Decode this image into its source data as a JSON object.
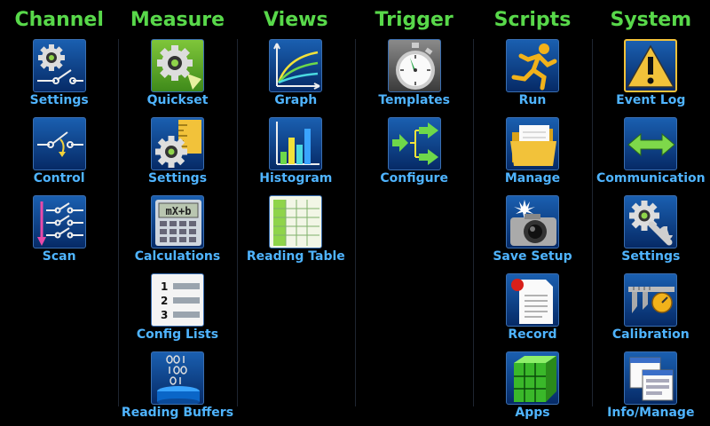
{
  "channel": {
    "title": "Channel",
    "settings": "Settings",
    "control": "Control",
    "scan": "Scan"
  },
  "measure": {
    "title": "Measure",
    "quickset": "Quickset",
    "settings": "Settings",
    "calculations": "Calculations",
    "config_lists": "Config Lists",
    "reading_buffers": "Reading Buffers",
    "calc_display": "mX+b",
    "list_numbers": [
      "1",
      "2",
      "3"
    ]
  },
  "views": {
    "title": "Views",
    "graph": "Graph",
    "histogram": "Histogram",
    "reading_table": "Reading Table"
  },
  "trigger": {
    "title": "Trigger",
    "templates": "Templates",
    "configure": "Configure"
  },
  "scripts": {
    "title": "Scripts",
    "run": "Run",
    "manage": "Manage",
    "save_setup": "Save Setup",
    "record": "Record",
    "apps": "Apps"
  },
  "system": {
    "title": "System",
    "event_log": "Event Log",
    "communication": "Communication",
    "settings": "Settings",
    "calibration": "Calibration",
    "info_manage": "Info/Manage"
  },
  "colors": {
    "heading": "#58d84a",
    "label": "#4fb4ff",
    "icon_bg_top": "#1a5fb0",
    "icon_bg_bottom": "#062a66",
    "background": "#000000"
  }
}
